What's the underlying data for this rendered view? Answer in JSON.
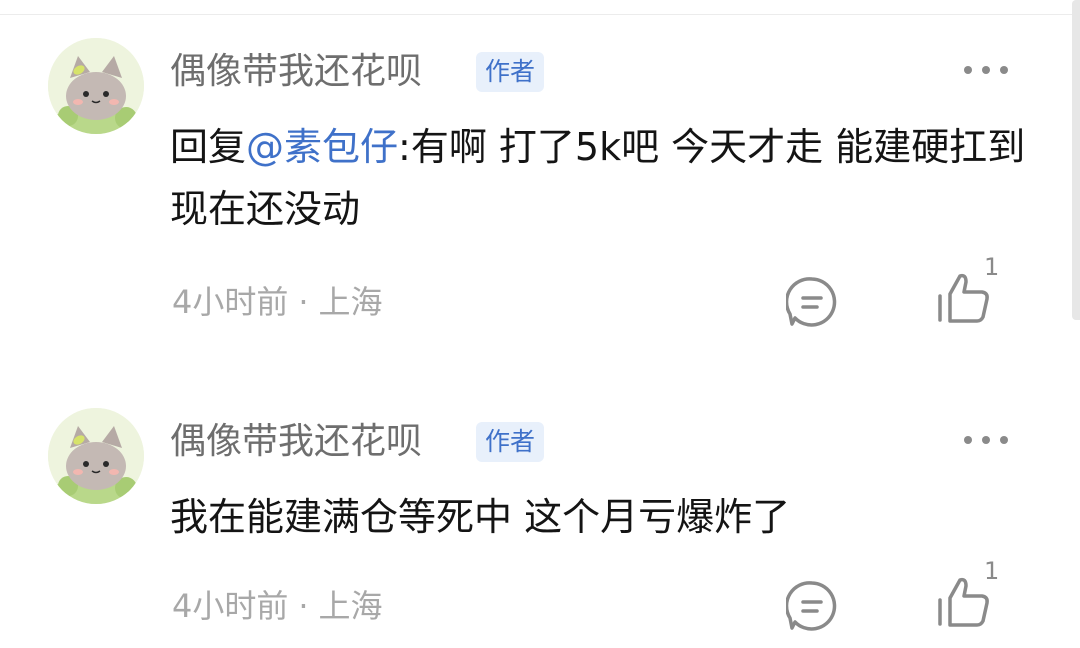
{
  "comments": [
    {
      "username": "偶像带我还花呗",
      "badge": "作者",
      "reply_prefix": "回复",
      "mention": "@素包仔",
      "text": ":有啊 打了5k吧 今天才走 能建硬扛到现在还没动",
      "time": "4小时前",
      "separator": "·",
      "location": "上海",
      "like_count": "1"
    },
    {
      "username": "偶像带我还花呗",
      "badge": "作者",
      "text": "我在能建满仓等死中 这个月亏爆炸了",
      "time": "4小时前",
      "separator": "·",
      "location": "上海",
      "like_count": "1"
    }
  ],
  "colors": {
    "mention": "#3f71c9",
    "badge_bg": "#e8f0fb",
    "meta": "#a8a8a8",
    "icon": "#8a8a8a"
  },
  "icons": {
    "more": "more-dots-icon",
    "reply": "comment-bubble-icon",
    "like": "thumbs-up-icon"
  }
}
